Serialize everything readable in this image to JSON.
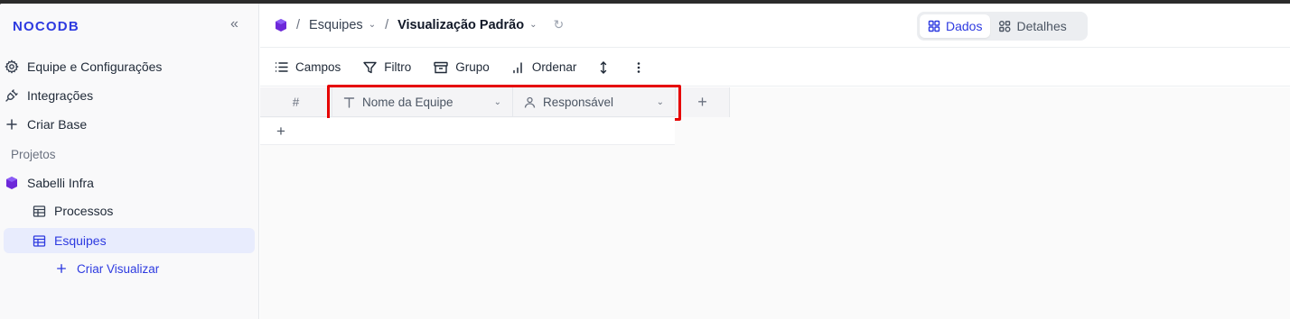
{
  "brand": {
    "logo": "NOCODB",
    "accent": "#2d3ae0"
  },
  "sidebar": {
    "items": [
      {
        "label": "Equipe e Configurações",
        "icon": "gear-icon"
      },
      {
        "label": "Integrações",
        "icon": "plug-icon"
      },
      {
        "label": "Criar Base",
        "icon": "plus-icon"
      }
    ],
    "section_label": "Projetos",
    "project": {
      "label": "Sabelli Infra",
      "icon": "base-icon"
    },
    "tables": [
      {
        "label": "Processos",
        "icon": "table-icon",
        "active": false
      },
      {
        "label": "Esquipes",
        "icon": "table-icon",
        "active": true
      }
    ],
    "create_view_label": "Criar Visualizar"
  },
  "topbar": {
    "breadcrumb": {
      "table": "Esquipes",
      "view": "Visualização Padrão"
    },
    "tabs": [
      {
        "label": "Dados",
        "active": true
      },
      {
        "label": "Detalhes",
        "active": false
      }
    ]
  },
  "toolbar": {
    "fields_label": "Campos",
    "filter_label": "Filtro",
    "group_label": "Grupo",
    "sort_label": "Ordenar"
  },
  "grid": {
    "index_header": "#",
    "columns": [
      {
        "label": "Nome da Equipe",
        "type_icon": "text-type-icon"
      },
      {
        "label": "Responsável",
        "type_icon": "user-type-icon"
      }
    ],
    "add_column": "+",
    "add_row": "+",
    "highlight_color": "#e60000"
  }
}
